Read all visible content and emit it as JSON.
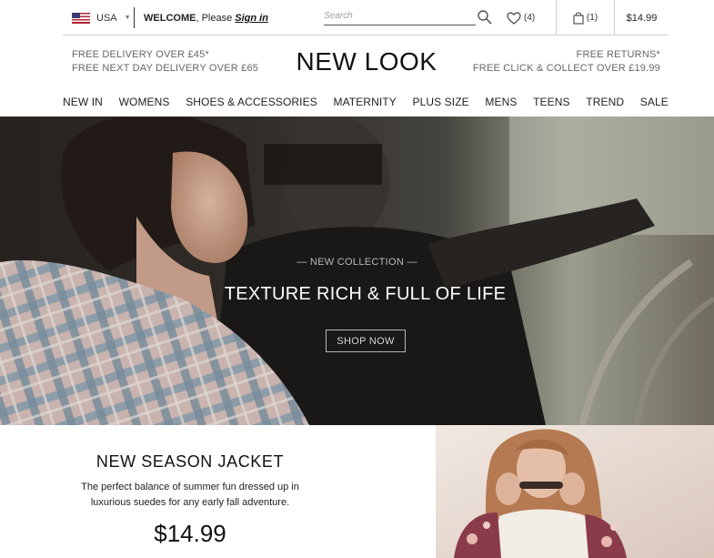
{
  "topbar": {
    "country": "USA",
    "welcome_prefix": "WELCOME",
    "welcome_mid": ", Please ",
    "signin": "Sign in",
    "search_placeholder": "Search",
    "wishlist_count": "(4)",
    "cart_count": "(1)",
    "cart_total": "$14.99"
  },
  "promos": {
    "left": [
      "FREE DELIVERY OVER £45*",
      "FREE NEXT DAY DELIVERY OVER £65"
    ],
    "right": [
      "FREE RETURNS*",
      "FREE CLICK & COLLECT OVER £19.99"
    ]
  },
  "logo": "NEW LOOK",
  "nav": [
    "NEW IN",
    "WOMENS",
    "SHOES & ACCESSORIES",
    "MATERNITY",
    "PLUS SIZE",
    "MENS",
    "TEENS",
    "TREND",
    "SALE"
  ],
  "hero": {
    "eyebrow": "— NEW COLLECTION —",
    "headline": "TEXTURE RICH & FULL OF LIFE",
    "cta": "SHOP NOW"
  },
  "product": {
    "title": "NEW SEASON JACKET",
    "description": "The perfect balance of summer fun dressed up in luxurious suedes for any early fall adventure.",
    "price": "$14.99"
  },
  "icons": {
    "flag": "us-flag-icon",
    "dropdown": "caret-down-icon",
    "search": "search-icon",
    "wishlist": "heart-icon",
    "cart": "shopping-bag-icon"
  }
}
